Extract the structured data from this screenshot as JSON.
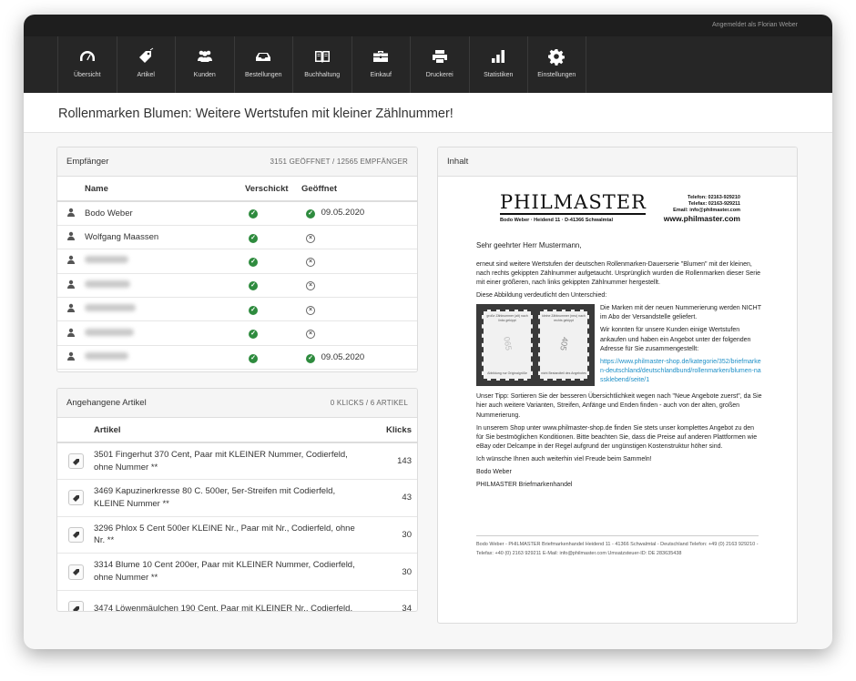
{
  "topbar": {
    "logged_in": "Angemeldet als Florian Weber"
  },
  "nav": [
    {
      "label": "Übersicht",
      "icon": "dashboard-icon"
    },
    {
      "label": "Artikel",
      "icon": "tag-icon"
    },
    {
      "label": "Kunden",
      "icon": "users-icon"
    },
    {
      "label": "Bestellungen",
      "icon": "inbox-icon"
    },
    {
      "label": "Buchhaltung",
      "icon": "book-icon"
    },
    {
      "label": "Einkauf",
      "icon": "briefcase-icon"
    },
    {
      "label": "Druckerei",
      "icon": "printer-icon"
    },
    {
      "label": "Statistiken",
      "icon": "bar-chart-icon"
    },
    {
      "label": "Einstellungen",
      "icon": "gear-icon"
    }
  ],
  "page": {
    "title": "Rollenmarken Blumen: Weitere Wertstufen mit kleiner Zählnummer!"
  },
  "recipients": {
    "title": "Empfänger",
    "meta": "3151 GEÖFFNET / 12565 EMPFÄNGER",
    "headers": {
      "name": "Name",
      "sent": "Verschickt",
      "opened": "Geöffnet"
    },
    "rows": [
      {
        "name": "Bodo Weber",
        "sent": true,
        "opened": true,
        "date": "09.05.2020"
      },
      {
        "name": "Wolfgang Maassen",
        "sent": true,
        "opened": false,
        "date": ""
      },
      {
        "name": "",
        "sent": true,
        "opened": false,
        "date": ""
      },
      {
        "name": "",
        "sent": true,
        "opened": false,
        "date": ""
      },
      {
        "name": "",
        "sent": true,
        "opened": false,
        "date": ""
      },
      {
        "name": "",
        "sent": true,
        "opened": false,
        "date": ""
      },
      {
        "name": "",
        "sent": true,
        "opened": true,
        "date": "09.05.2020"
      }
    ]
  },
  "articles": {
    "title": "Angehangene Artikel",
    "meta": "0 KLICKS / 6 ARTIKEL",
    "headers": {
      "article": "Artikel",
      "clicks": "Klicks"
    },
    "rows": [
      {
        "name": "3501 Fingerhut 370 Cent, Paar mit KLEINER Nummer, Codierfeld, ohne Nummer **",
        "clicks": "143"
      },
      {
        "name": "3469 Kapuzinerkresse 80 C. 500er, 5er-Streifen mit Codierfeld, KLEINE Nummer **",
        "clicks": "43"
      },
      {
        "name": "3296 Phlox 5 Cent 500er KLEINE Nr., Paar mit Nr., Codierfeld, ohne Nr. **",
        "clicks": "30"
      },
      {
        "name": "3314 Blume 10 Cent 200er, Paar mit KLEINER Nummer, Codierfeld, ohne Nummer **",
        "clicks": "30"
      },
      {
        "name": "3474 Löwenmäulchen 190 Cent, Paar mit KLEINER Nr., Codierfeld,",
        "clicks": "34"
      }
    ]
  },
  "content": {
    "title": "Inhalt",
    "letterhead": {
      "brand": "PHILMASTER",
      "address": "Bodo Weber · Heidend 11 · D-41366 Schwalmtal",
      "phone": "Telefon: 02163-929210",
      "fax": "Telefax: 02163-929211",
      "email": "Email: info@philmaster.com",
      "web": "www.philmaster.com"
    },
    "greeting": "Sehr geehrter Herr Mustermann,",
    "p1": "erneut sind weitere Wertstufen der deutschen Rollenmarken-Dauerserie \"Blumen\" mit der kleinen, nach rechts gekippten Zählnummer aufgetaucht. Ursprünglich wurden die Rollenmarken dieser Serie mit einer größeren, nach links gekippten Zählnummer hergestellt.",
    "p2": "Diese Abbildung verdeutlicht den Unterschied:",
    "stamp_left_caption": "große Zählnummer (alt) nach links gekippt",
    "stamp_right_caption": "kleine Zählnummer (neu) nach rechts gekippt",
    "stamp_left_number": "065",
    "stamp_right_number": "405",
    "stamp_left_bottom": "Abbildung nur Originalgröße",
    "stamp_right_bottom": "nicht Bestandteil des Angebotes",
    "side1": "Die Marken mit der neuen Nummerierung werden NICHT im Abo der Versandstelle geliefert.",
    "side2": "Wir konnten für unsere Kunden einige Wertstufen ankaufen und haben ein Angebot unter der folgenden Adresse für Sie zusammengestellt:",
    "link": "https://www.philmaster-shop.de/kategorie/352/briefmarken-deutschland/deutschlandbund/rollenmarken/blumen-nassklebend/seite/1",
    "p3": "Unser Tipp: Sortieren Sie der besseren Übersichtlichkeit wegen nach \"Neue Angebote zuerst\", da Sie hier auch weitere Varianten, Streifen, Anfänge und Enden finden - auch von der alten, großen Nummerierung.",
    "p4": "In unserem Shop unter www.philmaster-shop.de finden Sie stets unser komplettes Angebot zu den für Sie bestmöglichen Konditionen. Bitte beachten Sie, dass die Preise auf anderen Plattformen wie eBay oder Delcampe in der Regel aufgrund der ungünstigen Kostenstruktur höher sind.",
    "p5": "Ich wünsche Ihnen auch weiterhin viel Freude beim Sammeln!",
    "sign1": "Bodo Weber",
    "sign2": "PHILMASTER Briefmarkenhandel",
    "footer": "Bodo Weber - PHILMASTER Briefmarkenhandel Heidend 11 - 41366 Schwalmtal - Deutschland Telefon: +49 (0) 2163 929210 - Telefax: +40 (0) 2163 929211 E-Mail: info@philmaster.com Umsatzsteuer-ID: DE 283635438"
  }
}
